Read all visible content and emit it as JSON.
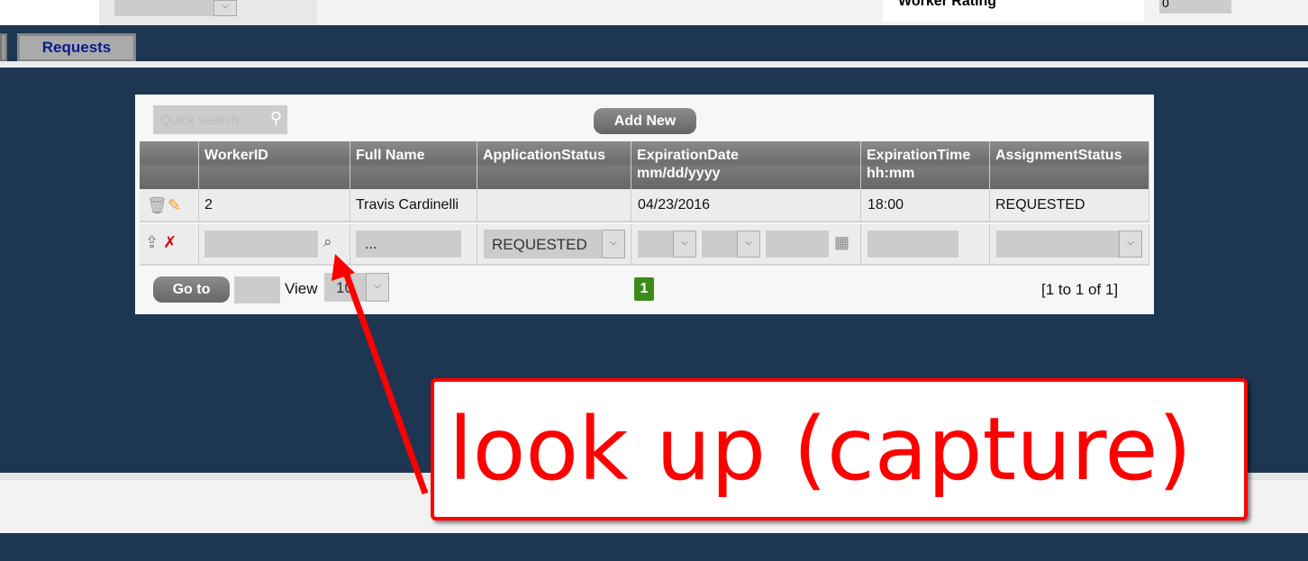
{
  "top": {
    "worker_rating_label": "Worker Rating",
    "worker_rating_value": "0"
  },
  "tabs": [
    {
      "label": "Requests"
    }
  ],
  "grid": {
    "search_placeholder": "Quick search",
    "add_new": "Add New",
    "columns": [
      "WorkerID",
      "Full Name",
      "ApplicationStatus",
      "ExpirationDate",
      "ExpirationTime",
      "AssignmentStatus"
    ],
    "column_subs": {
      "date": "mm/dd/yyyy",
      "time": "hh:mm"
    },
    "rows": [
      {
        "worker_id": "2",
        "full_name": "Travis Cardinelli",
        "application_status": "",
        "expiration_date": "04/23/2016",
        "expiration_time": "18:00",
        "assignment_status": "REQUESTED"
      }
    ],
    "edit_row": {
      "full_name": "...",
      "application_status": "REQUESTED"
    },
    "footer": {
      "goto": "Go to",
      "view": "View",
      "page_size": "10",
      "page": "1",
      "range": "[1 to 1 of 1]"
    }
  },
  "annotation": {
    "text": "look up (capture)",
    "color": "#ff0000"
  }
}
